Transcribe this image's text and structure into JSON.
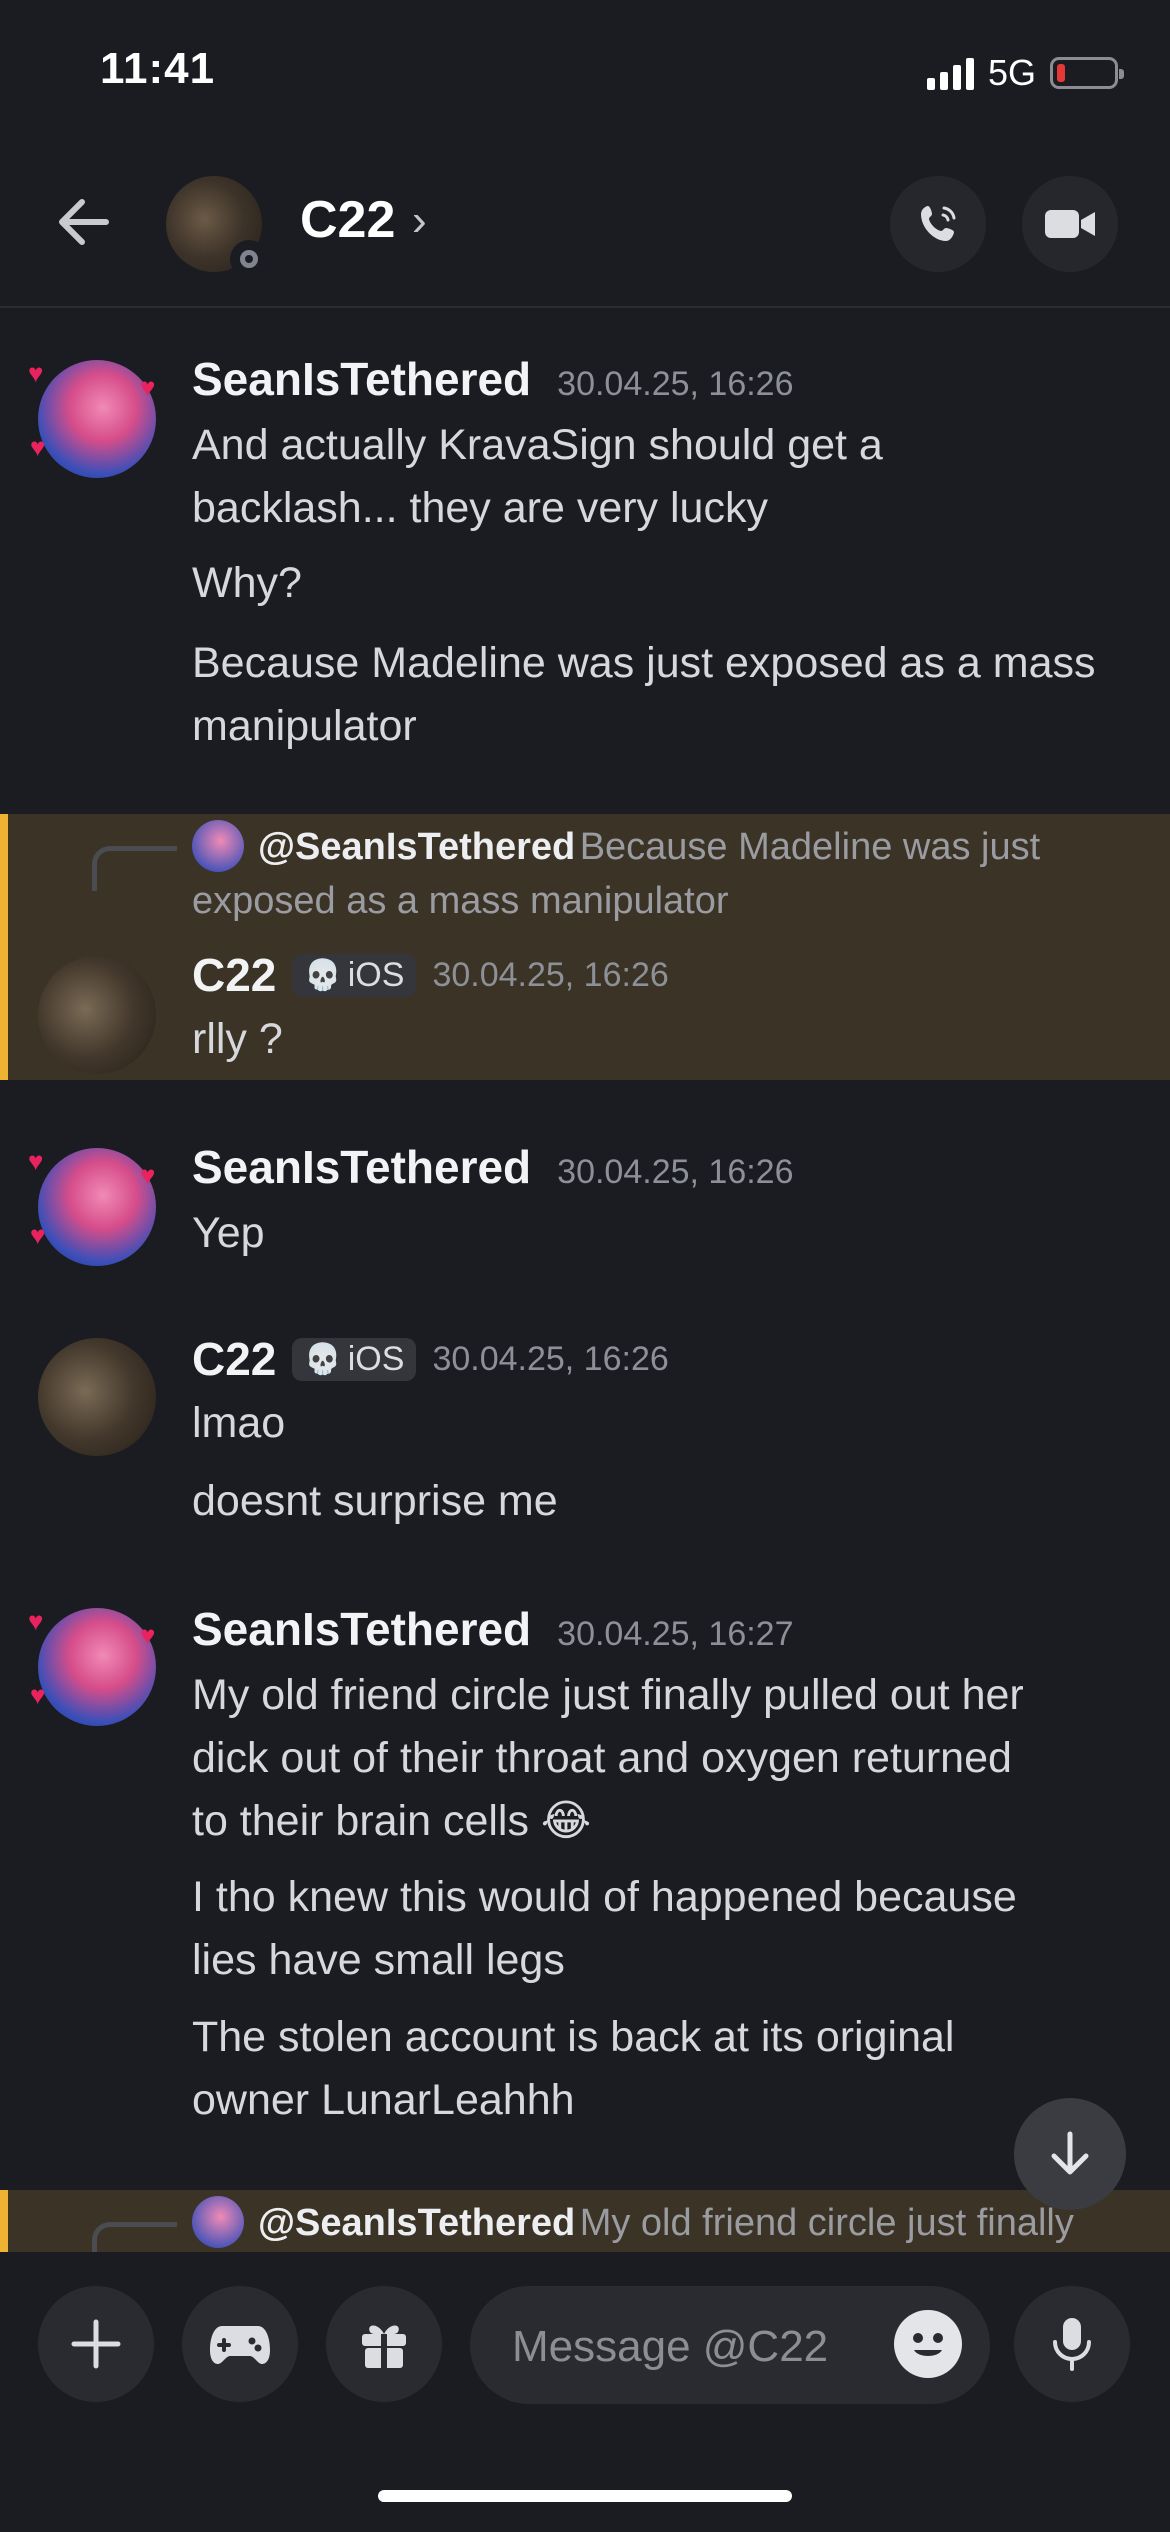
{
  "status_bar": {
    "time": "11:41",
    "network": "5G"
  },
  "header": {
    "title": "C22"
  },
  "messages": [
    {
      "author": "SeanIsTethered",
      "timestamp": "30.04.25, 16:26",
      "lines": [
        "And actually KravaSign should get a",
        "backlash... they are very lucky",
        "Why?",
        "Because Madeline was just exposed as a mass",
        "manipulator"
      ]
    },
    {
      "reply_to": "@SeanIsTethered",
      "reply_text_1": "Because Madeline was just",
      "reply_text_2": "exposed as a mass manipulator",
      "author": "C22",
      "badge": "iOS",
      "timestamp": "30.04.25, 16:26",
      "lines": [
        "rlly ?"
      ]
    },
    {
      "author": "SeanIsTethered",
      "timestamp": "30.04.25, 16:26",
      "lines": [
        "Yep"
      ]
    },
    {
      "author": "C22",
      "badge": "iOS",
      "timestamp": "30.04.25, 16:26",
      "lines": [
        "lmao",
        "doesnt surprise me"
      ]
    },
    {
      "author": "SeanIsTethered",
      "timestamp": "30.04.25, 16:27",
      "lines": [
        "My old friend circle just finally pulled out her",
        "dick out of their throat and oxygen returned",
        "to their brain cells 😂",
        "I tho knew this would of happened because",
        "lies have small legs",
        "The stolen account is back at its original",
        "owner LunarLeahhh"
      ]
    },
    {
      "reply_to": "@SeanIsTethered",
      "reply_text_1": "My old friend circle just finally"
    }
  ],
  "composer": {
    "placeholder": "Message @C22"
  }
}
